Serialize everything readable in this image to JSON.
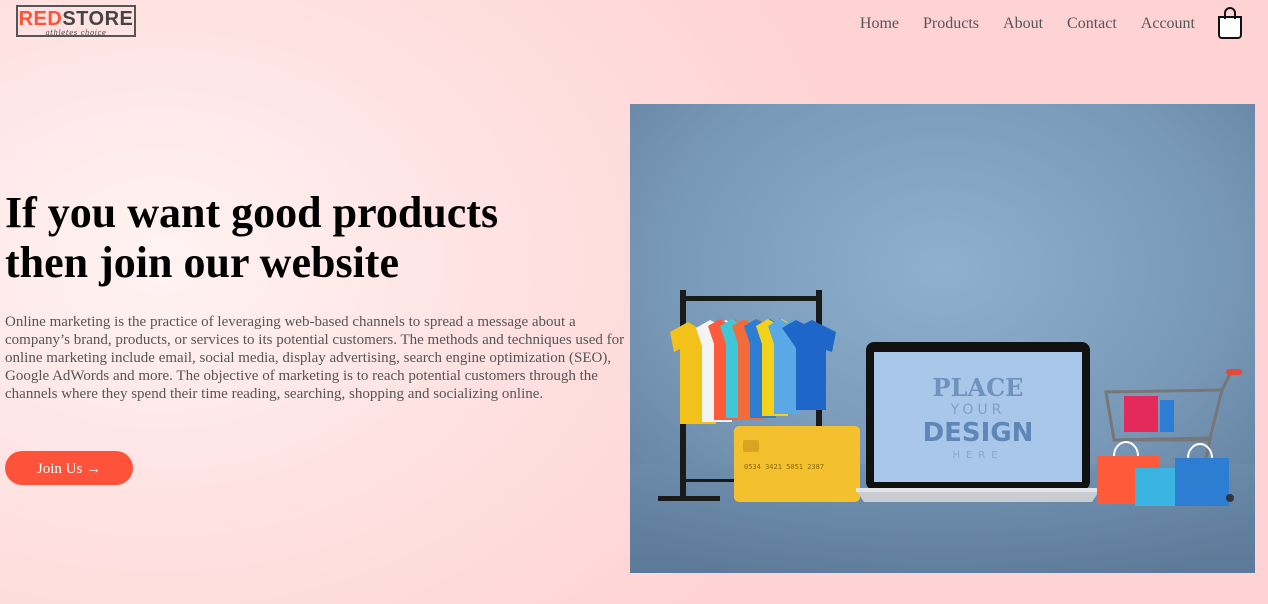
{
  "logo": {
    "brand_red": "RED",
    "brand_dark": "STORE",
    "tagline": "athletes choice"
  },
  "nav": {
    "items": [
      "Home",
      "Products",
      "About",
      "Contact",
      "Account"
    ],
    "cart_icon": "shopping-bag-icon"
  },
  "hero": {
    "title_line1": "If you want good products",
    "title_line2": "then join our website",
    "description": "Online marketing is the practice of leveraging web-based channels to spread a message about a company’s brand, products, or services to its potential customers. The methods and techniques used for online marketing include email, social media, display advertising, search engine optimization (SEO), Google AdWords and more. The objective of marketing is to reach potential customers through the channels where they spend their time reading, searching, shopping and socializing online.",
    "button_label": "Join Us →",
    "image": {
      "screen_line1": "PLACE",
      "screen_line2": "YOUR",
      "screen_line3": "DESIGN",
      "screen_line4": "HERE",
      "card_number": "0534 3421 5051 2387"
    }
  },
  "colors": {
    "accent": "#ff523b",
    "image_background": "#7b9bbb"
  }
}
